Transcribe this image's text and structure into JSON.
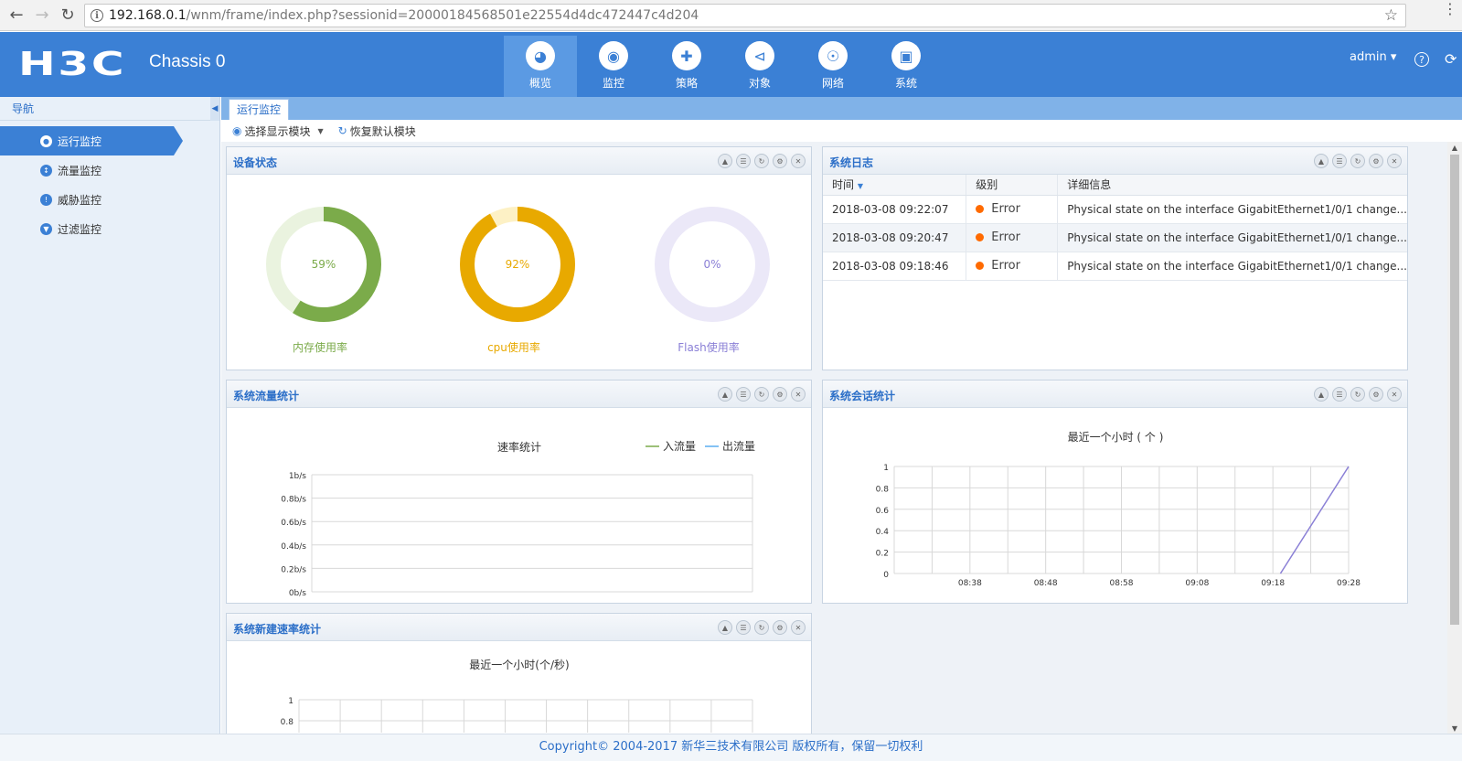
{
  "browser": {
    "url_host": "192.168.0.1",
    "url_path": "/wnm/frame/index.php?sessionid=20000184568501e22554d4dc472447c4d204"
  },
  "header": {
    "logo": "H3C",
    "device": "Chassis 0",
    "user": "admin",
    "nav": [
      {
        "label": "概览",
        "icon": "dashboard-icon",
        "active": true
      },
      {
        "label": "监控",
        "icon": "monitor-icon"
      },
      {
        "label": "策略",
        "icon": "shield-icon"
      },
      {
        "label": "对象",
        "icon": "share-icon"
      },
      {
        "label": "网络",
        "icon": "globe-icon"
      },
      {
        "label": "系统",
        "icon": "system-icon"
      }
    ]
  },
  "sidebar": {
    "title": "导航",
    "items": [
      {
        "label": "运行监控",
        "active": true
      },
      {
        "label": "流量监控"
      },
      {
        "label": "威胁监控"
      },
      {
        "label": "过滤监控"
      }
    ]
  },
  "tab": {
    "label": "运行监控"
  },
  "toolbar": {
    "select_modules": "选择显示模块",
    "restore_default": "恢复默认模块"
  },
  "panels": {
    "device_status": {
      "title": "设备状态",
      "gauges": [
        {
          "label": "内存使用率",
          "value": 59,
          "text": "59%",
          "color": "#7bab4a",
          "track": "#eaf3df"
        },
        {
          "label": "cpu使用率",
          "value": 92,
          "text": "92%",
          "color": "#e8a900",
          "track": "#fdf1c5"
        },
        {
          "label": "Flash使用率",
          "value": 0,
          "text": "0%",
          "color": "#8a7fd6",
          "track": "#ebe8f8"
        }
      ]
    },
    "system_log": {
      "title": "系统日志",
      "columns": [
        "时间",
        "级别",
        "详细信息"
      ],
      "rows": [
        {
          "time": "2018-03-08 09:22:07",
          "level": "Error",
          "detail": "Physical state on the interface GigabitEthernet1/0/1 change..."
        },
        {
          "time": "2018-03-08 09:20:47",
          "level": "Error",
          "detail": "Physical state on the interface GigabitEthernet1/0/1 change..."
        },
        {
          "time": "2018-03-08 09:18:46",
          "level": "Error",
          "detail": "Physical state on the interface GigabitEthernet1/0/1 change..."
        }
      ]
    },
    "traffic": {
      "title": "系统流量统计"
    },
    "session": {
      "title": "系统会话统计"
    },
    "new_rate": {
      "title": "系统新建速率统计"
    }
  },
  "chart_data": [
    {
      "type": "line",
      "title": "速率统计",
      "series": [
        {
          "name": "入流量",
          "color": "#7bab4a",
          "values": []
        },
        {
          "name": "出流量",
          "color": "#5aaef0",
          "values": []
        }
      ],
      "yticks": [
        "1b/s",
        "0.8b/s",
        "0.6b/s",
        "0.4b/s",
        "0.2b/s",
        "0b/s"
      ],
      "ylim": [
        0,
        1
      ]
    },
    {
      "type": "line",
      "title": "最近一个小时 ( 个 )",
      "x": [
        "09:19",
        "09:28"
      ],
      "series": [
        {
          "values": [
            0,
            1
          ],
          "color": "#8a7fd6"
        }
      ],
      "xticks": [
        "08:38",
        "08:48",
        "08:58",
        "09:08",
        "09:18",
        "09:28"
      ],
      "yticks": [
        "1",
        "0.8",
        "0.6",
        "0.4",
        "0.2",
        "0"
      ],
      "ylim": [
        0,
        1
      ]
    },
    {
      "type": "line",
      "title": "最近一个小时(个/秒)",
      "yticks": [
        "1",
        "0.8"
      ],
      "ylim": [
        0,
        1
      ]
    }
  ],
  "footer": "Copyright© 2004-2017 新华三技术有限公司 版权所有，保留一切权利"
}
